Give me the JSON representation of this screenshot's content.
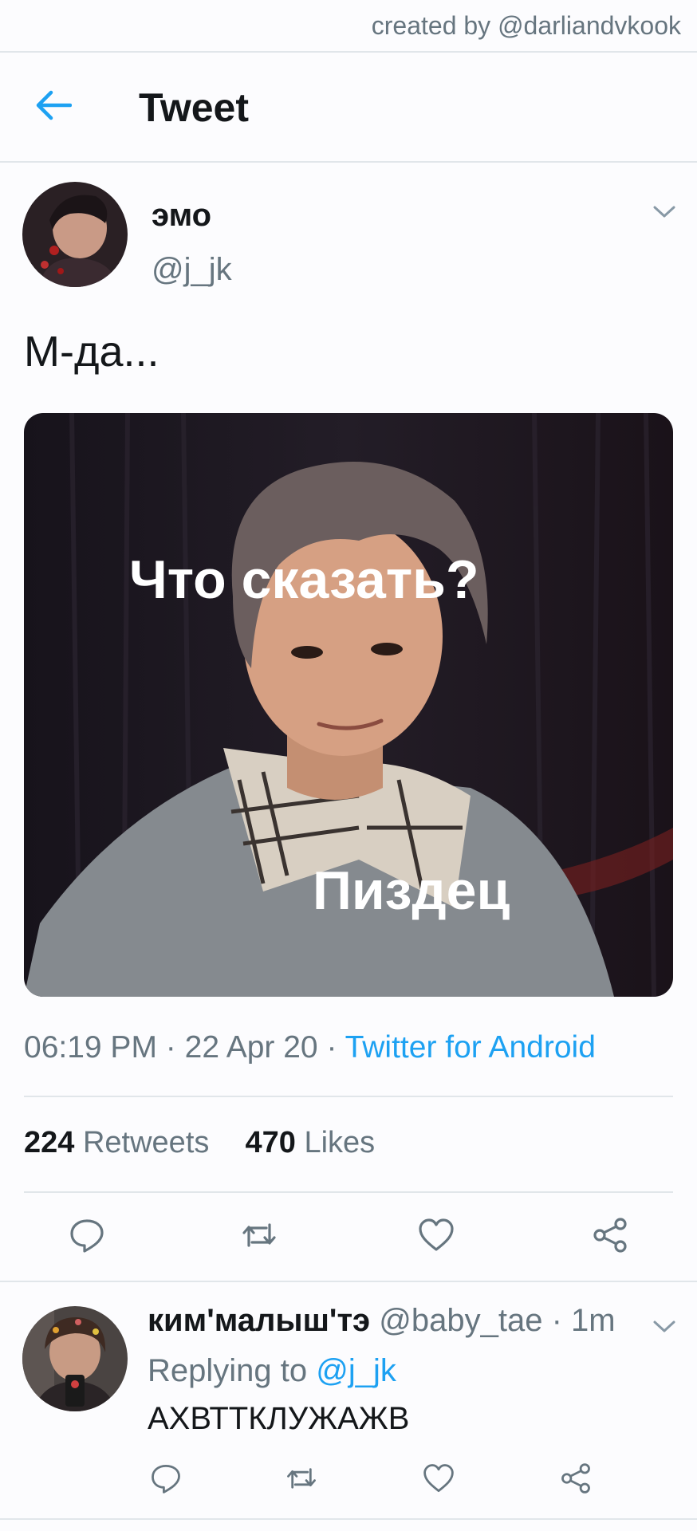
{
  "watermark": "created by @darliandvkook",
  "header": {
    "title": "Tweet",
    "back_icon": "arrow-left-icon"
  },
  "tweet": {
    "author_name": "эмо",
    "handle": "@j_jk",
    "text": "М-да...",
    "media": {
      "caption_top": "Что сказать?",
      "caption_bottom": "Пиздец"
    },
    "time": "06:19 PM",
    "date": "22 Apr 20",
    "separator": "·",
    "client": "Twitter for Android",
    "retweets_count": "224",
    "retweets_label": "Retweets",
    "likes_count": "470",
    "likes_label": "Likes"
  },
  "reply": {
    "author_name": "ким'малыш'тэ",
    "handle": "@baby_tae",
    "separator": "·",
    "time": "1m",
    "replying_to_label": "Replying to",
    "replying_to_handle": "@j_jk",
    "text": "АХВТТКЛУЖАЖВ"
  },
  "colors": {
    "accent": "#1da1f2",
    "muted": "#66757f",
    "text": "#14171a",
    "divider": "#e1e6ea"
  },
  "icons": [
    "arrow-left-icon",
    "chevron-down-icon",
    "reply-icon",
    "retweet-icon",
    "like-icon",
    "share-icon"
  ]
}
